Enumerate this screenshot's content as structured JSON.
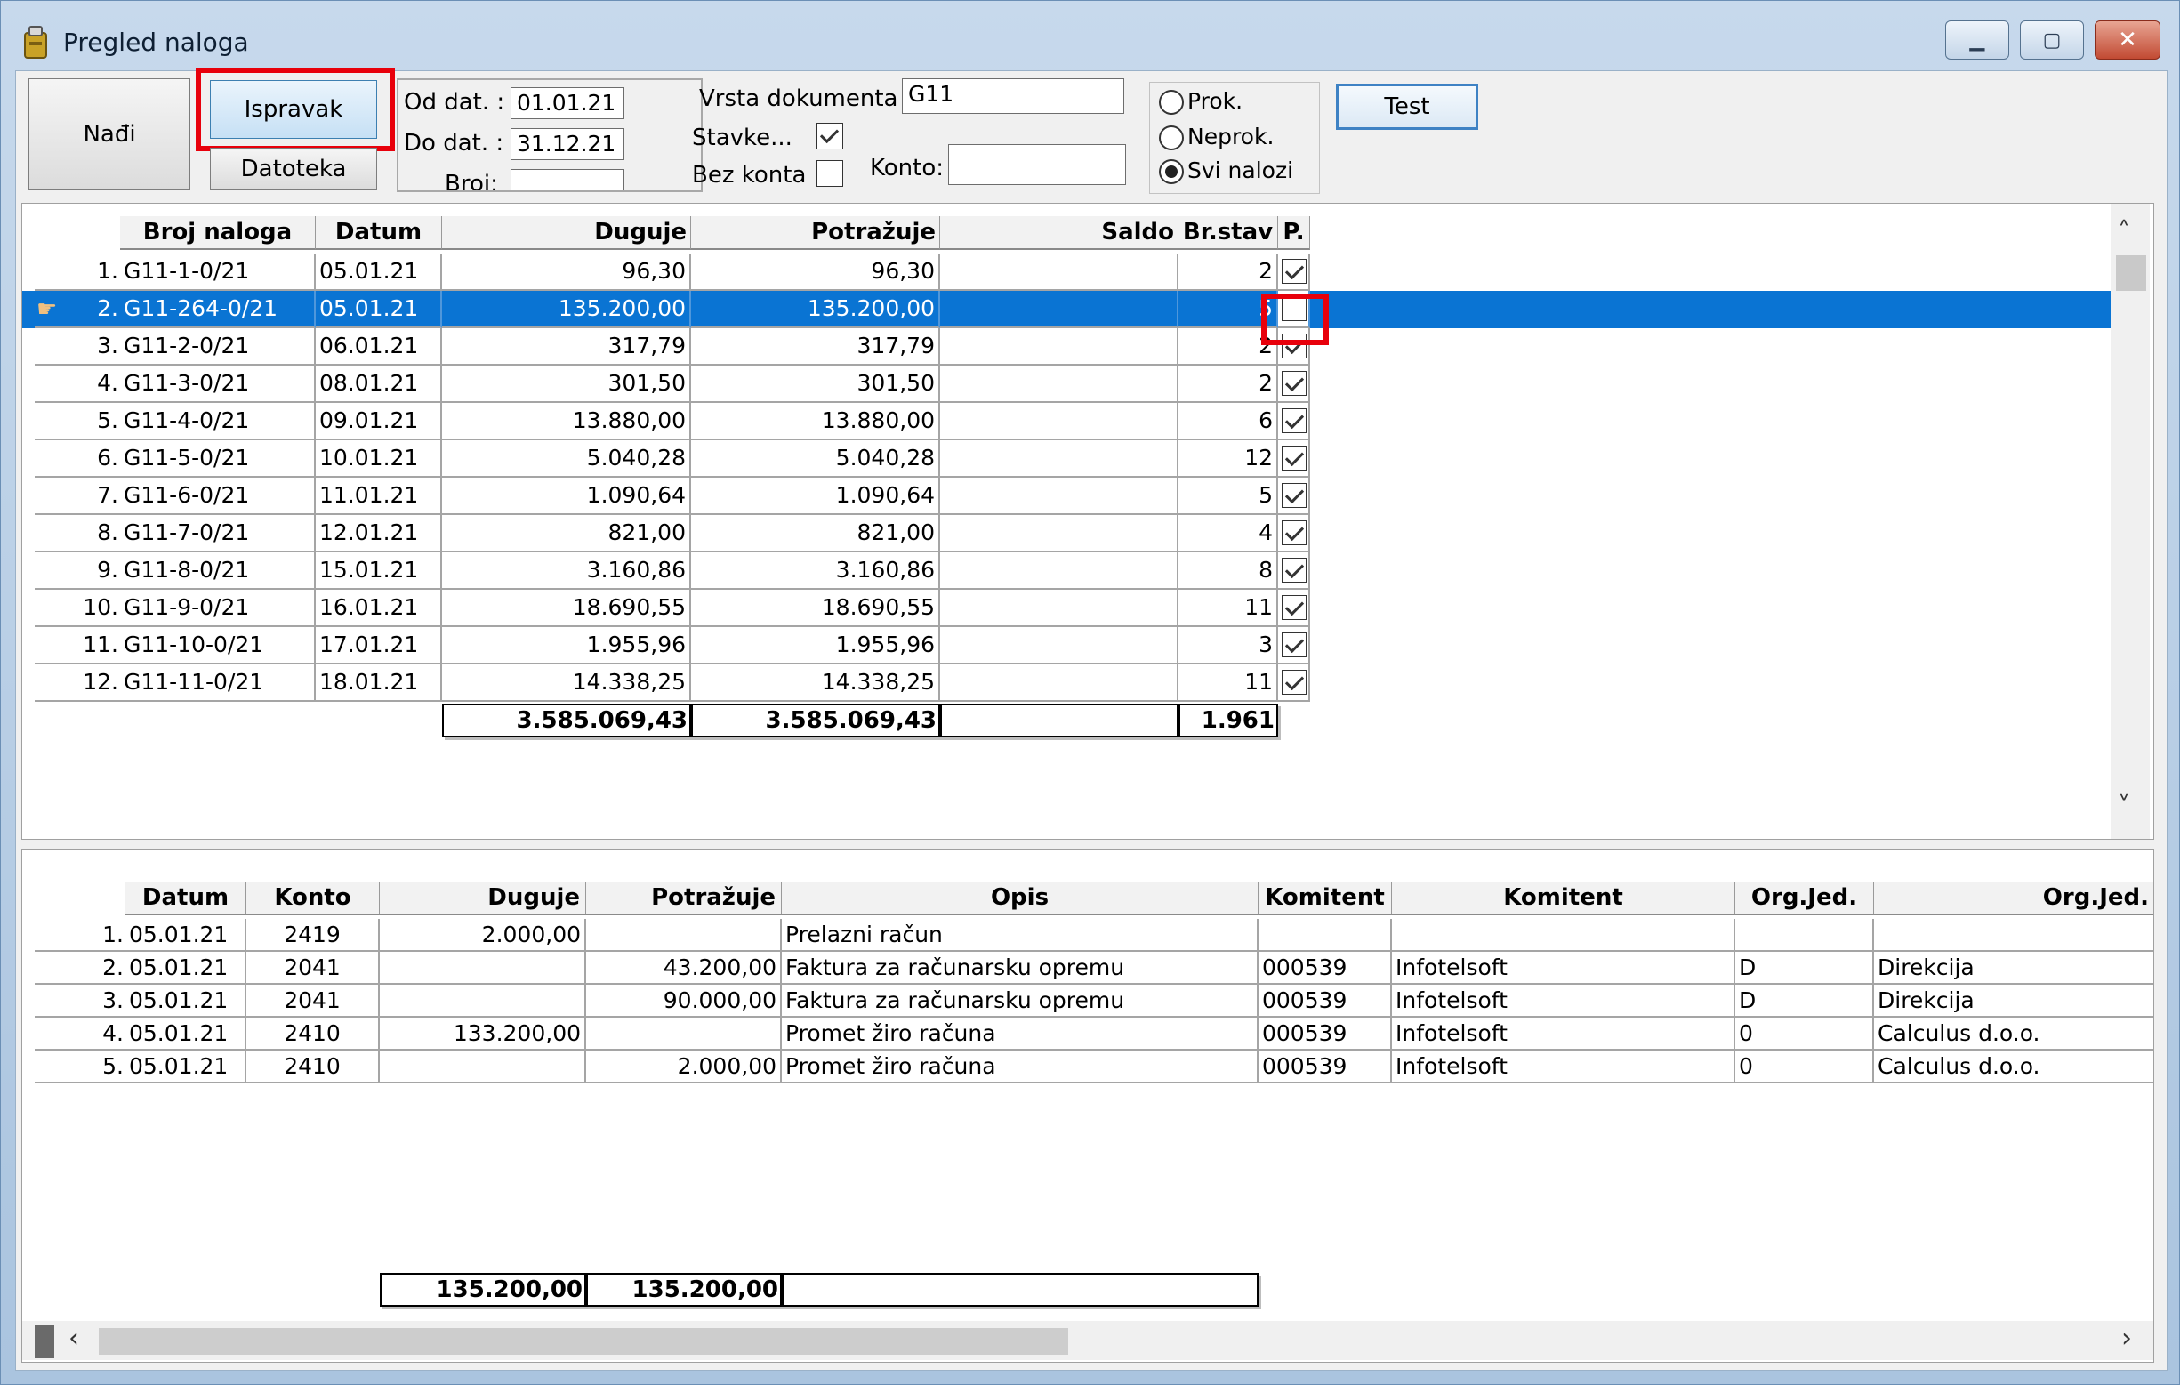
{
  "window": {
    "title": "Pregled naloga"
  },
  "toolbar": {
    "find_label": "Nađi",
    "edit_label": "Ispravak",
    "file_label": "Datoteka",
    "test_label": "Test"
  },
  "filter": {
    "od_dat_label": "Od dat. :",
    "od_dat_value": "01.01.21",
    "do_dat_label": "Do dat. :",
    "do_dat_value": "31.12.21",
    "broj_label": "Broj:",
    "broj_value": "",
    "vrsta_label": "Vrsta dokumenta :",
    "vrsta_value": "G11",
    "stavke_label": "Stavke...",
    "stavke_checked": true,
    "bez_konta_label": "Bez konta",
    "bez_konta_checked": false,
    "konto_label": "Konto:",
    "konto_value": ""
  },
  "status_filter": {
    "options": [
      "Prok.",
      "Neprok.",
      "Svi nalozi"
    ],
    "selected": "Svi nalozi"
  },
  "top_table": {
    "columns": [
      "Broj naloga",
      "Datum",
      "Duguje",
      "Potražuje",
      "Saldo",
      "Br.stav",
      "P."
    ],
    "rows": [
      {
        "n": "1.",
        "broj": "G11-1-0/21",
        "datum": "05.01.21",
        "duguje": "96,30",
        "potrazuje": "96,30",
        "saldo": "",
        "brstav": "2",
        "p": true
      },
      {
        "n": "2.",
        "broj": "G11-264-0/21",
        "datum": "05.01.21",
        "duguje": "135.200,00",
        "potrazuje": "135.200,00",
        "saldo": "",
        "brstav": "5",
        "p": false
      },
      {
        "n": "3.",
        "broj": "G11-2-0/21",
        "datum": "06.01.21",
        "duguje": "317,79",
        "potrazuje": "317,79",
        "saldo": "",
        "brstav": "2",
        "p": true
      },
      {
        "n": "4.",
        "broj": "G11-3-0/21",
        "datum": "08.01.21",
        "duguje": "301,50",
        "potrazuje": "301,50",
        "saldo": "",
        "brstav": "2",
        "p": true
      },
      {
        "n": "5.",
        "broj": "G11-4-0/21",
        "datum": "09.01.21",
        "duguje": "13.880,00",
        "potrazuje": "13.880,00",
        "saldo": "",
        "brstav": "6",
        "p": true
      },
      {
        "n": "6.",
        "broj": "G11-5-0/21",
        "datum": "10.01.21",
        "duguje": "5.040,28",
        "potrazuje": "5.040,28",
        "saldo": "",
        "brstav": "12",
        "p": true
      },
      {
        "n": "7.",
        "broj": "G11-6-0/21",
        "datum": "11.01.21",
        "duguje": "1.090,64",
        "potrazuje": "1.090,64",
        "saldo": "",
        "brstav": "5",
        "p": true
      },
      {
        "n": "8.",
        "broj": "G11-7-0/21",
        "datum": "12.01.21",
        "duguje": "821,00",
        "potrazuje": "821,00",
        "saldo": "",
        "brstav": "4",
        "p": true
      },
      {
        "n": "9.",
        "broj": "G11-8-0/21",
        "datum": "15.01.21",
        "duguje": "3.160,86",
        "potrazuje": "3.160,86",
        "saldo": "",
        "brstav": "8",
        "p": true
      },
      {
        "n": "10.",
        "broj": "G11-9-0/21",
        "datum": "16.01.21",
        "duguje": "18.690,55",
        "potrazuje": "18.690,55",
        "saldo": "",
        "brstav": "11",
        "p": true
      },
      {
        "n": "11.",
        "broj": "G11-10-0/21",
        "datum": "17.01.21",
        "duguje": "1.955,96",
        "potrazuje": "1.955,96",
        "saldo": "",
        "brstav": "3",
        "p": true
      },
      {
        "n": "12.",
        "broj": "G11-11-0/21",
        "datum": "18.01.21",
        "duguje": "14.338,25",
        "potrazuje": "14.338,25",
        "saldo": "",
        "brstav": "11",
        "p": true
      }
    ],
    "selected_row": 1,
    "totals": {
      "duguje": "3.585.069,43",
      "potrazuje": "3.585.069,43",
      "saldo": "",
      "brstav": "1.961"
    }
  },
  "bottom_table": {
    "columns": [
      "Datum",
      "Konto",
      "Duguje",
      "Potražuje",
      "Opis",
      "Komitent",
      "Komitent",
      "Org.Jed.",
      "Org.Jed."
    ],
    "rows": [
      {
        "n": "1.",
        "datum": "05.01.21",
        "konto": "2419",
        "duguje": "2.000,00",
        "potrazuje": "",
        "opis": "Prelazni račun",
        "kom1": "",
        "kom2": "",
        "org1": "",
        "org2": ""
      },
      {
        "n": "2.",
        "datum": "05.01.21",
        "konto": "2041",
        "duguje": "",
        "potrazuje": "43.200,00",
        "opis": "Faktura za računarsku opremu",
        "kom1": "000539",
        "kom2": "Infotelsoft",
        "org1": "D",
        "org2": "Direkcija"
      },
      {
        "n": "3.",
        "datum": "05.01.21",
        "konto": "2041",
        "duguje": "",
        "potrazuje": "90.000,00",
        "opis": "Faktura za računarsku opremu",
        "kom1": "000539",
        "kom2": "Infotelsoft",
        "org1": "D",
        "org2": "Direkcija"
      },
      {
        "n": "4.",
        "datum": "05.01.21",
        "konto": "2410",
        "duguje": "133.200,00",
        "potrazuje": "",
        "opis": "Promet žiro računa",
        "kom1": "000539",
        "kom2": "Infotelsoft",
        "org1": "0",
        "org2": "Calculus d.o.o."
      },
      {
        "n": "5.",
        "datum": "05.01.21",
        "konto": "2410",
        "duguje": "",
        "potrazuje": "2.000,00",
        "opis": "Promet žiro računa",
        "kom1": "000539",
        "kom2": "Infotelsoft",
        "org1": "0",
        "org2": "Calculus d.o.o."
      }
    ],
    "totals": {
      "duguje": "135.200,00",
      "potrazuje": "135.200,00",
      "opis": ""
    }
  },
  "colors": {
    "selection": "#0a74d3",
    "highlight": "#e8000b"
  }
}
